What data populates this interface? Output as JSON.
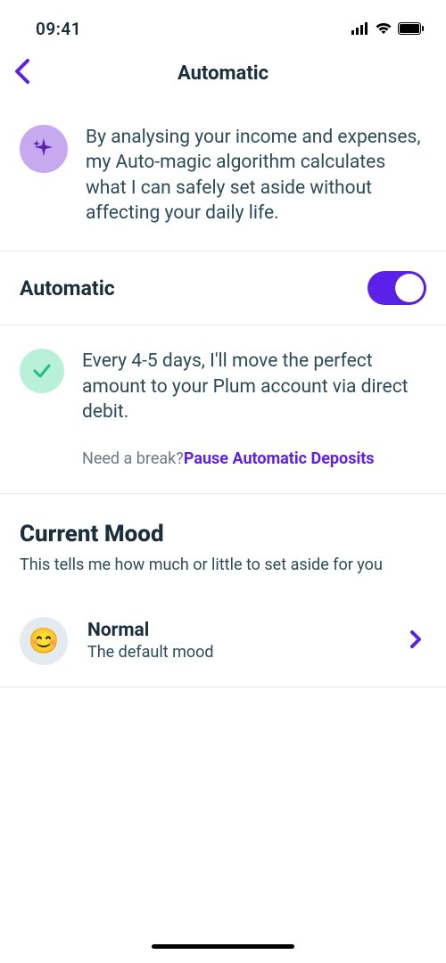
{
  "status": {
    "time": "09:41"
  },
  "header": {
    "title": "Automatic"
  },
  "intro": {
    "text": "By analysing your income and expenses, my Auto-magic algorithm calculates what I can safely set aside without affecting your daily life."
  },
  "automatic": {
    "label": "Automatic",
    "enabled": true
  },
  "schedule": {
    "text": "Every 4-5 days, I'll move the perfect amount to your Plum account via direct debit."
  },
  "pause": {
    "prompt": "Need a break?",
    "link": "Pause Automatic Deposits"
  },
  "mood": {
    "title": "Current Mood",
    "subtitle": "This tells me how much or little to set aside for you",
    "current": {
      "emoji": "😊",
      "name": "Normal",
      "desc": "The default mood"
    }
  },
  "colors": {
    "accent": "#5b21e8",
    "check_bg": "#b9f0d9",
    "sparkle_bg": "#c7a9f0"
  }
}
